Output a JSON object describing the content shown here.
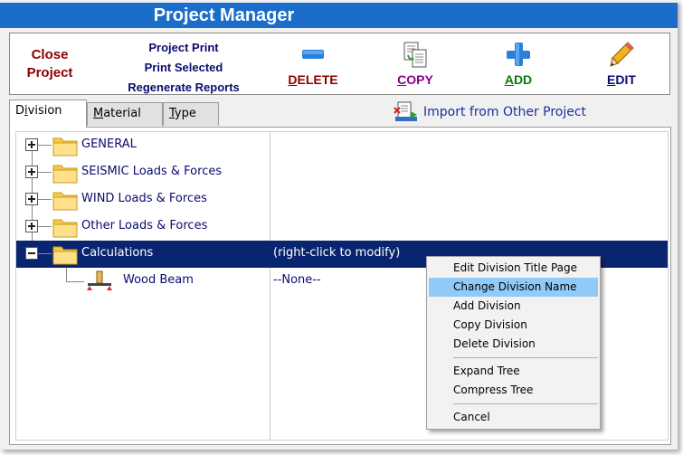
{
  "window": {
    "title": "Project Manager"
  },
  "toolbar": {
    "close_project": [
      "Close",
      "Project"
    ],
    "print_links": [
      "Project Print",
      "Print Selected",
      "Regenerate Reports"
    ],
    "buttons": [
      {
        "hot": "D",
        "rest": "ELETE",
        "icon": "minus-icon",
        "color": "#8b0000"
      },
      {
        "hot": "C",
        "rest": "OPY",
        "icon": "copy-icon",
        "color": "#8b008b"
      },
      {
        "hot": "A",
        "rest": "DD",
        "icon": "plus-icon",
        "color": "#0a7a0a"
      },
      {
        "hot": "E",
        "rest": "DIT",
        "icon": "pencil-icon",
        "color": "#0b0b70"
      }
    ]
  },
  "tabs": [
    {
      "pre": "D",
      "hot": "i",
      "post": "vision",
      "active": true
    },
    {
      "pre": "",
      "hot": "M",
      "post": "aterial",
      "active": false
    },
    {
      "pre": "",
      "hot": "T",
      "post": "ype",
      "active": false
    }
  ],
  "import": {
    "label": "Import from Other Project",
    "icon": "import-icon"
  },
  "tree": {
    "rows": [
      {
        "name": "GENERAL",
        "expanded": false
      },
      {
        "name": "SEISMIC Loads & Forces",
        "expanded": false
      },
      {
        "name": "WIND Loads & Forces",
        "expanded": false
      },
      {
        "name": "Other Loads & Forces",
        "expanded": false
      },
      {
        "name": "Calculations",
        "expanded": true,
        "selected": true,
        "note": "(right-click to modify)"
      }
    ],
    "child": {
      "name": "Wood Beam",
      "note": "--None--",
      "icon": "beam-icon"
    }
  },
  "context_menu": {
    "items": [
      "Edit Division Title Page",
      "Change Division Name",
      "Add Division",
      "Copy Division",
      "Delete Division",
      "Expand Tree",
      "Compress Tree",
      "Cancel"
    ],
    "hovered_index": 1
  },
  "colors": {
    "titlebar": "#1a6dc9",
    "selection": "#0a2570",
    "menu_hover": "#91c9f7"
  }
}
